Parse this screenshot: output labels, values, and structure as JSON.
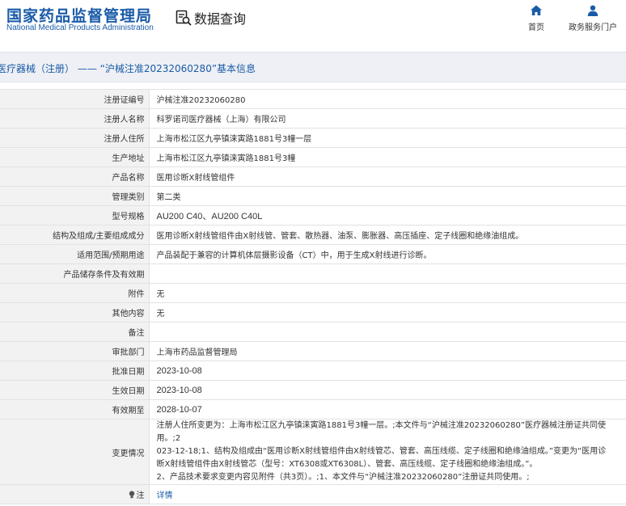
{
  "header": {
    "logo_cn": "国家药品监督管理局",
    "logo_en": "National Medical Products Administration",
    "query_title": "数据查询",
    "nav_home": "首页",
    "nav_portal": "政务服务门户"
  },
  "breadcrumb": "医疗器械（注册） —— “沪械注准20232060280”基本信息",
  "fields": [
    {
      "label": "注册证编号",
      "value": "沪械注准20232060280"
    },
    {
      "label": "注册人名称",
      "value": "科罗诺司医疗器械（上海）有限公司"
    },
    {
      "label": "注册人住所",
      "value": "上海市松江区九亭镇涞寅路1881号3幢一层"
    },
    {
      "label": "生产地址",
      "value": "上海市松江区九亭镇涞寅路1881号3幢"
    },
    {
      "label": "产品名称",
      "value": "医用诊断X射线管组件"
    },
    {
      "label": "管理类别",
      "value": "第二类"
    },
    {
      "label": "型号规格",
      "value": "AU200 C40、AU200 C40L"
    },
    {
      "label": "结构及组成/主要组成成分",
      "value": "医用诊断X射线管组件由X射线管、管套、散热器、油泵、膨胀器、高压插座、定子线圈和绝缘油组成。"
    },
    {
      "label": "适用范围/预期用途",
      "value": "产品装配于兼容的计算机体层摄影设备（CT）中，用于生成X射线进行诊断。"
    },
    {
      "label": "产品储存条件及有效期",
      "value": ""
    },
    {
      "label": "附件",
      "value": "无"
    },
    {
      "label": "其他内容",
      "value": "无"
    },
    {
      "label": "备注",
      "value": ""
    },
    {
      "label": "审批部门",
      "value": "上海市药品监督管理局"
    },
    {
      "label": "批准日期",
      "value": "2023-10-08"
    },
    {
      "label": "生效日期",
      "value": "2023-10-08"
    },
    {
      "label": "有效期至",
      "value": "2028-10-07"
    }
  ],
  "change": {
    "label": "变更情况",
    "lines": [
      "注册人住所变更为：上海市松江区九亭镇涞寅路1881号3幢一层。;本文件与“沪械注准20232060280”医疗器械注册证共同使用。;2",
      "023-12-18;1、结构及组成由“医用诊断X射线管组件由X射线管芯、管套、高压线缆、定子线圈和绝缘油组成。”变更为“医用诊",
      "断X射线管组件由X射线管芯（型号：XT6308或XT6308L）、管套、高压线缆、定子线圈和绝缘油组成。”。",
      "2、产品技术要求变更内容见附件（共3页）。;1、本文件与“沪械注准20232060280”注册证共同使用。;"
    ]
  },
  "note": {
    "label": "注",
    "link": "详情"
  }
}
